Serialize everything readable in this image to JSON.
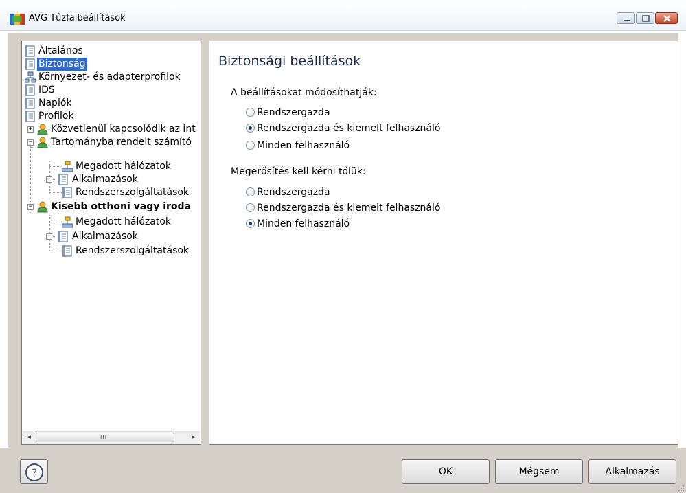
{
  "window": {
    "title": "AVG Tűzfalbeállítások",
    "icon": "avg-logo-icon",
    "controls": [
      "minimize-icon",
      "maximize-icon",
      "close-icon"
    ]
  },
  "tree": {
    "items": [
      {
        "label": "Általános",
        "icon": "page-icon"
      },
      {
        "label": "Biztonság",
        "icon": "page-icon",
        "selected": true
      },
      {
        "label": "Környezet- és adapterprofilok",
        "icon": "network-icon"
      },
      {
        "label": "IDS",
        "icon": "page-icon"
      },
      {
        "label": "Naplók",
        "icon": "page-icon"
      },
      {
        "label": "Profilok",
        "icon": "page-icon"
      },
      {
        "label": "Közvetlenül kapcsolódik az int",
        "icon": "user-icon",
        "expander": "+"
      },
      {
        "label": "Tartományba rendelt számító",
        "icon": "user-icon",
        "expander": "−"
      },
      {
        "label": "Megadott hálózatok",
        "icon": "network-icon"
      },
      {
        "label": "Alkalmazások",
        "icon": "page-icon",
        "expander": "+"
      },
      {
        "label": "Rendszerszolgáltatások",
        "icon": "page-icon"
      },
      {
        "label": "Kisebb otthoni vagy iroda",
        "icon": "user-icon",
        "expander": "−",
        "bold": true
      },
      {
        "label": "Megadott hálózatok",
        "icon": "network-icon"
      },
      {
        "label": "Alkalmazások",
        "icon": "page-icon",
        "expander": "+"
      },
      {
        "label": "Rendszerszolgáltatások",
        "icon": "page-icon"
      }
    ],
    "scrollbar": {
      "left_arrow": "◄",
      "right_arrow": "►",
      "grip": "III"
    }
  },
  "content": {
    "heading": "Biztonsági beállítások",
    "groups": [
      {
        "label": "A beállításokat módosíthatják:",
        "options": [
          {
            "label": "Rendszergazda",
            "checked": false
          },
          {
            "label": "Rendszergazda és kiemelt felhasználó",
            "checked": true
          },
          {
            "label": "Minden felhasználó",
            "checked": false
          }
        ]
      },
      {
        "label": "Megerősítés kell kérni tőlük:",
        "options": [
          {
            "label": "Rendszergazda",
            "checked": false
          },
          {
            "label": "Rendszergazda és kiemelt felhasználó",
            "checked": false
          },
          {
            "label": "Minden felhasználó",
            "checked": true
          }
        ]
      }
    ]
  },
  "footer": {
    "help_icon": "help-icon",
    "ok": "OK",
    "cancel": "Mégsem",
    "apply": "Alkalmazás"
  }
}
